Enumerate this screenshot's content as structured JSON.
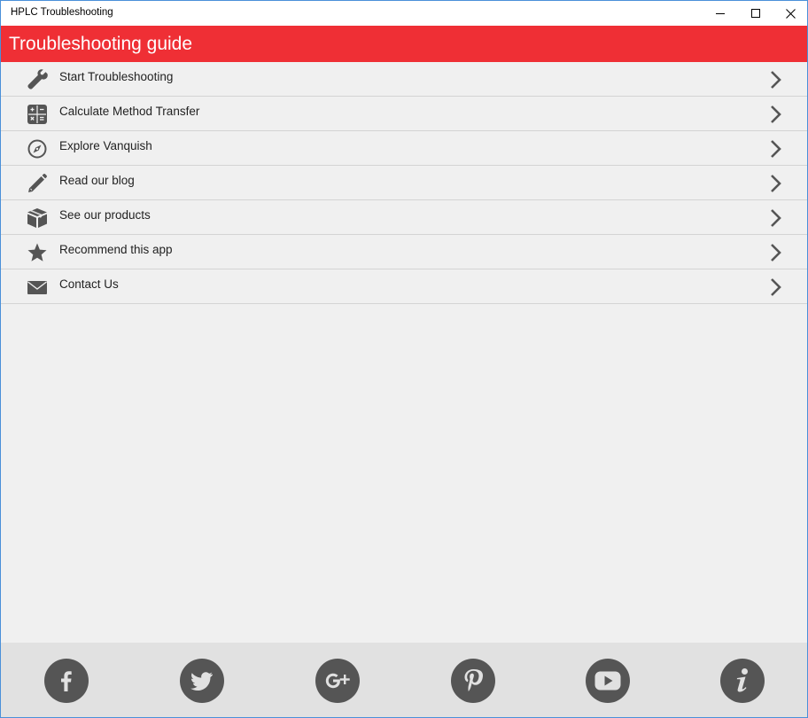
{
  "window": {
    "title": "HPLC Troubleshooting"
  },
  "header": {
    "title": "Troubleshooting guide"
  },
  "menu": {
    "items": [
      {
        "label": "Start Troubleshooting",
        "icon": "wrench-icon"
      },
      {
        "label": "Calculate Method Transfer",
        "icon": "calculator-icon"
      },
      {
        "label": "Explore Vanquish",
        "icon": "compass-icon"
      },
      {
        "label": "Read our blog",
        "icon": "pencil-icon"
      },
      {
        "label": "See our products",
        "icon": "box-icon"
      },
      {
        "label": "Recommend this app",
        "icon": "star-icon"
      },
      {
        "label": "Contact Us",
        "icon": "envelope-icon"
      }
    ]
  },
  "footer": {
    "social": [
      "facebook-icon",
      "twitter-icon",
      "google-plus-icon",
      "pinterest-icon",
      "youtube-icon",
      "info-icon"
    ]
  },
  "colors": {
    "accent": "#ef2f35",
    "icon_gray": "#555555",
    "background": "#f0f0f0",
    "footer": "#e1e1e1"
  }
}
